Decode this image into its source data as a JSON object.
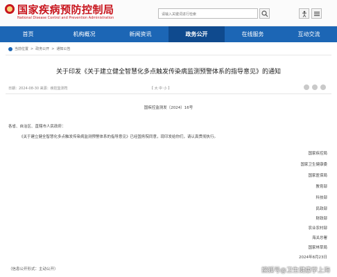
{
  "header": {
    "site_title": "国家疾病预防控制局",
    "site_subtitle": "National Disease Control and Prevention Administration",
    "search_placeholder": "请输入关键词进行检索"
  },
  "nav": {
    "items": [
      "首页",
      "机构概况",
      "新闻资讯",
      "政务公开",
      "在线服务",
      "互动交流"
    ],
    "active_index": 3
  },
  "breadcrumb": [
    "当前位置",
    "政务公开",
    "通知公告"
  ],
  "document": {
    "title": "关于印发《关于建立健全智慧化多点触发传染病监测预警体系的指导意见》的通知",
    "meta_date": "日期：2024-08-30  来源：疾控监测司",
    "meta_font": "【 大  中  小 】",
    "doc_number": "国疾控监测发〔2024〕16号",
    "salutation": "各省、自治区、直辖市人民政府：",
    "body": "《关于建立健全智慧化多点触发传染病监测预警体系的指导意见》已经国务院同意，现印发给你们，请认真贯彻执行。",
    "signatories": [
      "国家疾控局",
      "国家卫生健康委",
      "国家医保局",
      "教育部",
      "科技部",
      "民政部",
      "财政部",
      "农业农村部",
      "海关总署",
      "国家林草局"
    ],
    "date": "2024年8月23日",
    "disclosure": "（信息公开形式：主动公开）"
  },
  "watermark": "搜狐号@卫生健康学上海",
  "colors": {
    "brand_red": "#c8151d",
    "nav_blue": "#1c66b5",
    "nav_active": "#0f4a8e"
  }
}
